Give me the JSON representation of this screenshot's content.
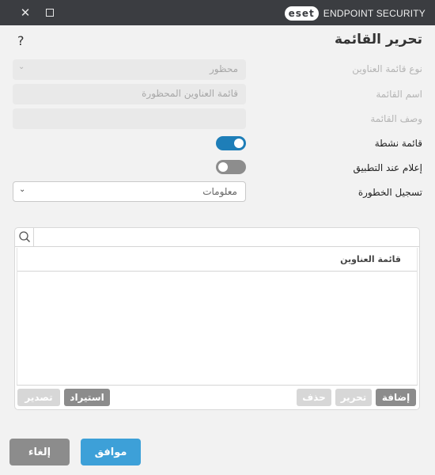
{
  "titlebar": {
    "close_glyph": "✕",
    "logo_text": "eset",
    "product_name": "ENDPOINT SECURITY"
  },
  "help_glyph": "?",
  "page_title": "تحرير القائمة",
  "form": {
    "list_type_label": "نوع قائمة العناوين",
    "list_type_value": "محظور",
    "list_name_label": "اسم القائمة",
    "list_name_value": "قائمة العناوين المحظورة",
    "list_description_label": "وصف القائمة",
    "list_description_value": "",
    "list_active_label": "قائمة نشطة",
    "list_active_on": true,
    "notify_label": "إعلام عند التطبيق",
    "notify_on": false,
    "severity_label": "تسجيل الخطورة",
    "severity_value": "معلومات"
  },
  "panel": {
    "search_placeholder": "",
    "column_header": "قائمة العناوين",
    "buttons": {
      "add": "إضافة",
      "edit": "تحرير",
      "delete": "حذف",
      "import": "استيراد",
      "export": "تصدير"
    }
  },
  "footer": {
    "ok": "موافق",
    "cancel": "إلغاء"
  },
  "colors": {
    "titlebar": "#3b3d41",
    "accent": "#3da0d8",
    "toggle_on": "#1e7eb8",
    "toggle_off": "#8d8d8d",
    "button_gray": "#8c8c8c"
  }
}
